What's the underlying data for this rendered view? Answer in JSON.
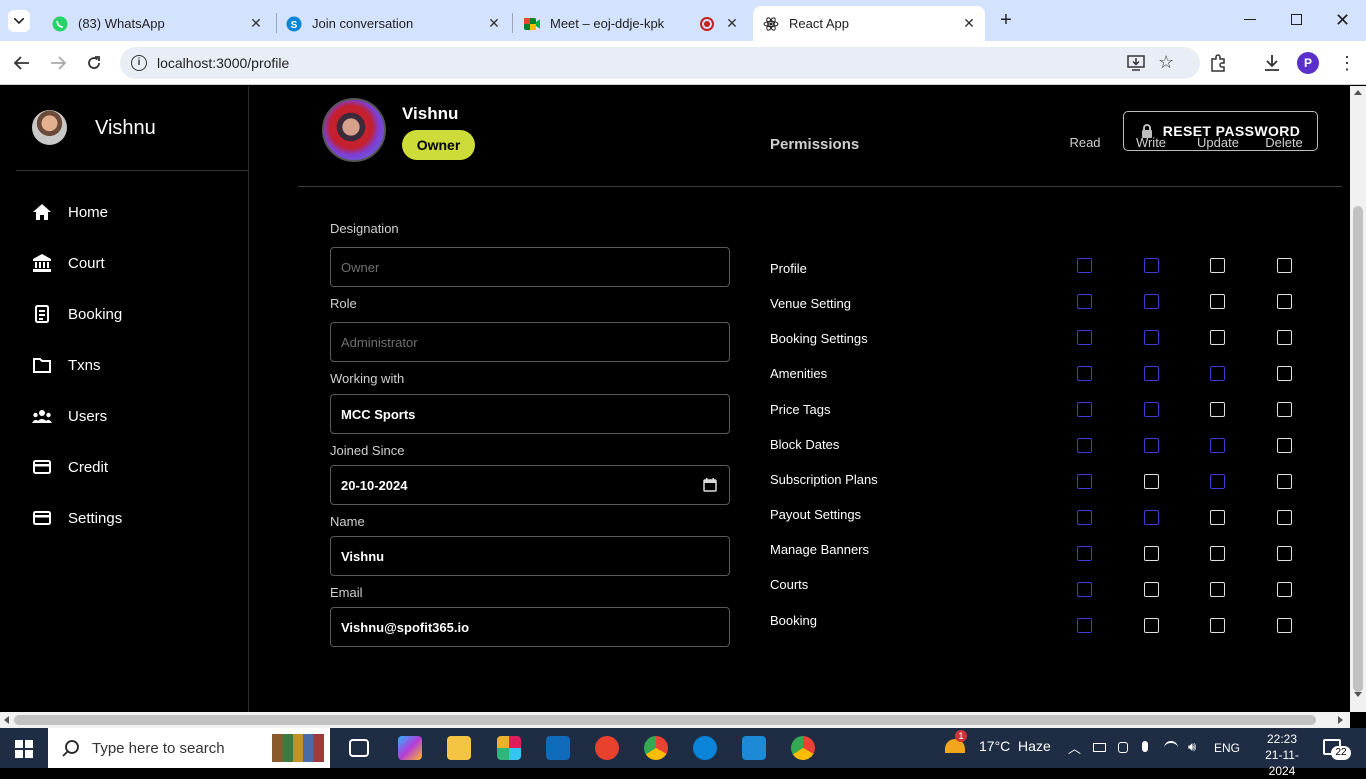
{
  "browser": {
    "tabs": [
      {
        "title": "(83) WhatsApp",
        "icon": "whatsapp-icon"
      },
      {
        "title": "Join conversation",
        "icon": "skype-icon"
      },
      {
        "title": "Meet – eoj-ddje-kpk",
        "icon": "google-meet-icon"
      },
      {
        "title": "React App",
        "icon": "react-icon"
      }
    ],
    "url": "localhost:3000/profile",
    "profile_initial": "P"
  },
  "sidebar": {
    "user_name": "Vishnu",
    "items": [
      {
        "label": "Home",
        "icon": "home-icon"
      },
      {
        "label": "Court",
        "icon": "bank-icon"
      },
      {
        "label": "Booking",
        "icon": "receipt-icon"
      },
      {
        "label": "Txns",
        "icon": "folder-icon"
      },
      {
        "label": "Users",
        "icon": "group-icon"
      },
      {
        "label": "Credit",
        "icon": "credit-card-icon"
      },
      {
        "label": "Settings",
        "icon": "credit-card-icon"
      }
    ]
  },
  "profile": {
    "name": "Vishnu",
    "badge": "Owner",
    "reset_label": "RESET PASSWORD"
  },
  "form": {
    "fields": [
      {
        "label": "Designation",
        "placeholder": "Owner",
        "value": ""
      },
      {
        "label": "Role",
        "placeholder": "Administrator",
        "value": ""
      },
      {
        "label": "Working with",
        "value": "MCC Sports"
      },
      {
        "label": "Joined Since",
        "value": "20-10-2024"
      },
      {
        "label": "Name",
        "value": "Vishnu"
      },
      {
        "label": "Email",
        "value": "Vishnu@spofit365.io"
      }
    ]
  },
  "permissions": {
    "title": "Permissions",
    "columns": [
      "Read",
      "Write",
      "Update",
      "Delete"
    ],
    "rows": [
      {
        "label": "Profile",
        "checked": [
          false,
          false,
          false,
          false
        ]
      },
      {
        "label": "Venue Setting",
        "checked": [
          false,
          false,
          false,
          false
        ]
      },
      {
        "label": "Booking Settings",
        "checked": [
          false,
          false,
          false,
          false
        ]
      },
      {
        "label": "Amenities",
        "checked": [
          false,
          false,
          false,
          false
        ]
      },
      {
        "label": "Price Tags",
        "checked": [
          false,
          false,
          false,
          false
        ]
      },
      {
        "label": "Block Dates",
        "checked": [
          false,
          false,
          false,
          false
        ]
      },
      {
        "label": "Subscription Plans",
        "checked": [
          false,
          false,
          false,
          false
        ]
      },
      {
        "label": "Payout Settings",
        "checked": [
          false,
          false,
          false,
          false
        ]
      },
      {
        "label": "Manage Banners",
        "checked": [
          false,
          false,
          false,
          false
        ]
      },
      {
        "label": "Courts",
        "checked": [
          false,
          false,
          false,
          false
        ]
      },
      {
        "label": "Booking",
        "checked": [
          false,
          false,
          false,
          false
        ]
      }
    ]
  },
  "taskbar": {
    "search_placeholder": "Type here to search",
    "weather": "17°C  Haze",
    "weather_alert": "1",
    "language": "ENG",
    "time": "22:23",
    "date": "21-11-2024",
    "notifications": "22"
  }
}
